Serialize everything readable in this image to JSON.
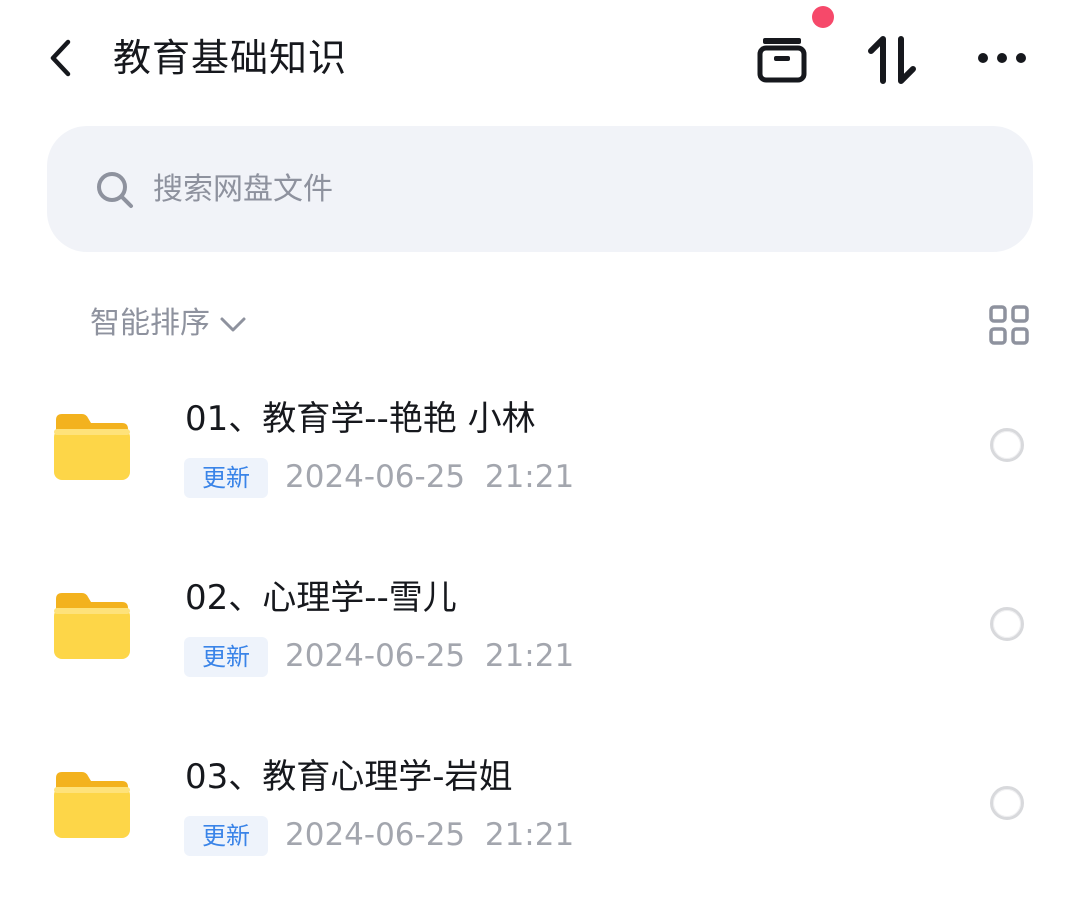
{
  "header": {
    "title": "教育基础知识",
    "icons": {
      "back": "chevron-left-icon",
      "transfer": "transfer-box-icon",
      "sort": "sort-arrows-icon",
      "more": "more-dots-icon"
    },
    "notification_color": "#f6496a"
  },
  "search": {
    "placeholder": "搜索网盘文件",
    "value": ""
  },
  "toolbar": {
    "sort_label": "智能排序",
    "view_icon": "grid-view-icon"
  },
  "files": [
    {
      "name": "01、教育学--艳艳 小林",
      "badge": "更新",
      "date": "2024-06-25  21:21",
      "type": "folder"
    },
    {
      "name": "02、心理学--雪儿",
      "badge": "更新",
      "date": "2024-06-25  21:21",
      "type": "folder"
    },
    {
      "name": "03、教育心理学-岩姐",
      "badge": "更新",
      "date": "2024-06-25  21:21",
      "type": "folder"
    }
  ],
  "colors": {
    "accent": "#3a84e8",
    "folder": "#fccf3c",
    "muted_text": "#8e929e"
  }
}
